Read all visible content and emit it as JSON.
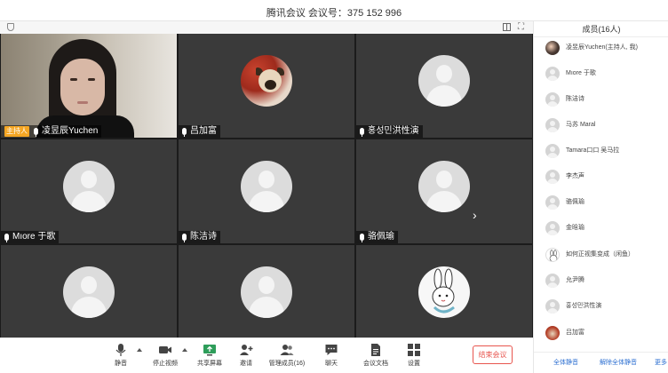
{
  "window": {
    "title": "腾讯会议  会议号：375 152 996"
  },
  "grid": {
    "participants": [
      {
        "name": "凌昱辰Yuchen",
        "host_badge": "主持人",
        "type": "video"
      },
      {
        "name": "吕加富",
        "type": "dog"
      },
      {
        "name": "홍성민洪性演",
        "type": "default"
      },
      {
        "name": "Mıore 于歌",
        "type": "default"
      },
      {
        "name": "陈洁诗",
        "type": "default"
      },
      {
        "name": "骆佩瑜",
        "type": "default"
      },
      {
        "name": "",
        "type": "default"
      },
      {
        "name": "",
        "type": "default"
      },
      {
        "name": "",
        "type": "rabbit"
      }
    ],
    "next_arrow": "›"
  },
  "toolbar": {
    "mute": "静音",
    "stop_video": "停止视频",
    "share_screen": "共享屏幕",
    "invite": "邀请",
    "manage_members": "管理成员(16)",
    "chat": "聊天",
    "meeting_docs": "会议文档",
    "settings": "设置",
    "end_meeting": "结束会议"
  },
  "members_panel": {
    "header": "成员(16人)",
    "members": [
      {
        "name": "凌昱辰Yuchen(主持人, 我)",
        "avatar": "photo"
      },
      {
        "name": "Mıore 于歌",
        "avatar": "default"
      },
      {
        "name": "陈洁诗",
        "avatar": "default"
      },
      {
        "name": "马苏 Maral",
        "avatar": "default"
      },
      {
        "name": "Tamara口口 吴马拉",
        "avatar": "default"
      },
      {
        "name": "李杰声",
        "avatar": "default"
      },
      {
        "name": "骆佩瑜",
        "avatar": "default"
      },
      {
        "name": "金晗瑜",
        "avatar": "default"
      },
      {
        "name": "如何正视集变成（闲鱼）",
        "avatar": "rabbit"
      },
      {
        "name": "允尹腾",
        "avatar": "default"
      },
      {
        "name": "홍성민洪性演",
        "avatar": "default"
      },
      {
        "name": "吕加富",
        "avatar": "dog"
      }
    ],
    "footer": {
      "mute_all": "全体静音",
      "unmute_all": "解除全体静音",
      "more": "更多"
    }
  },
  "colors": {
    "accent": "#2c6fd1",
    "danger": "#e8554e",
    "host_badge": "#f5a623"
  }
}
